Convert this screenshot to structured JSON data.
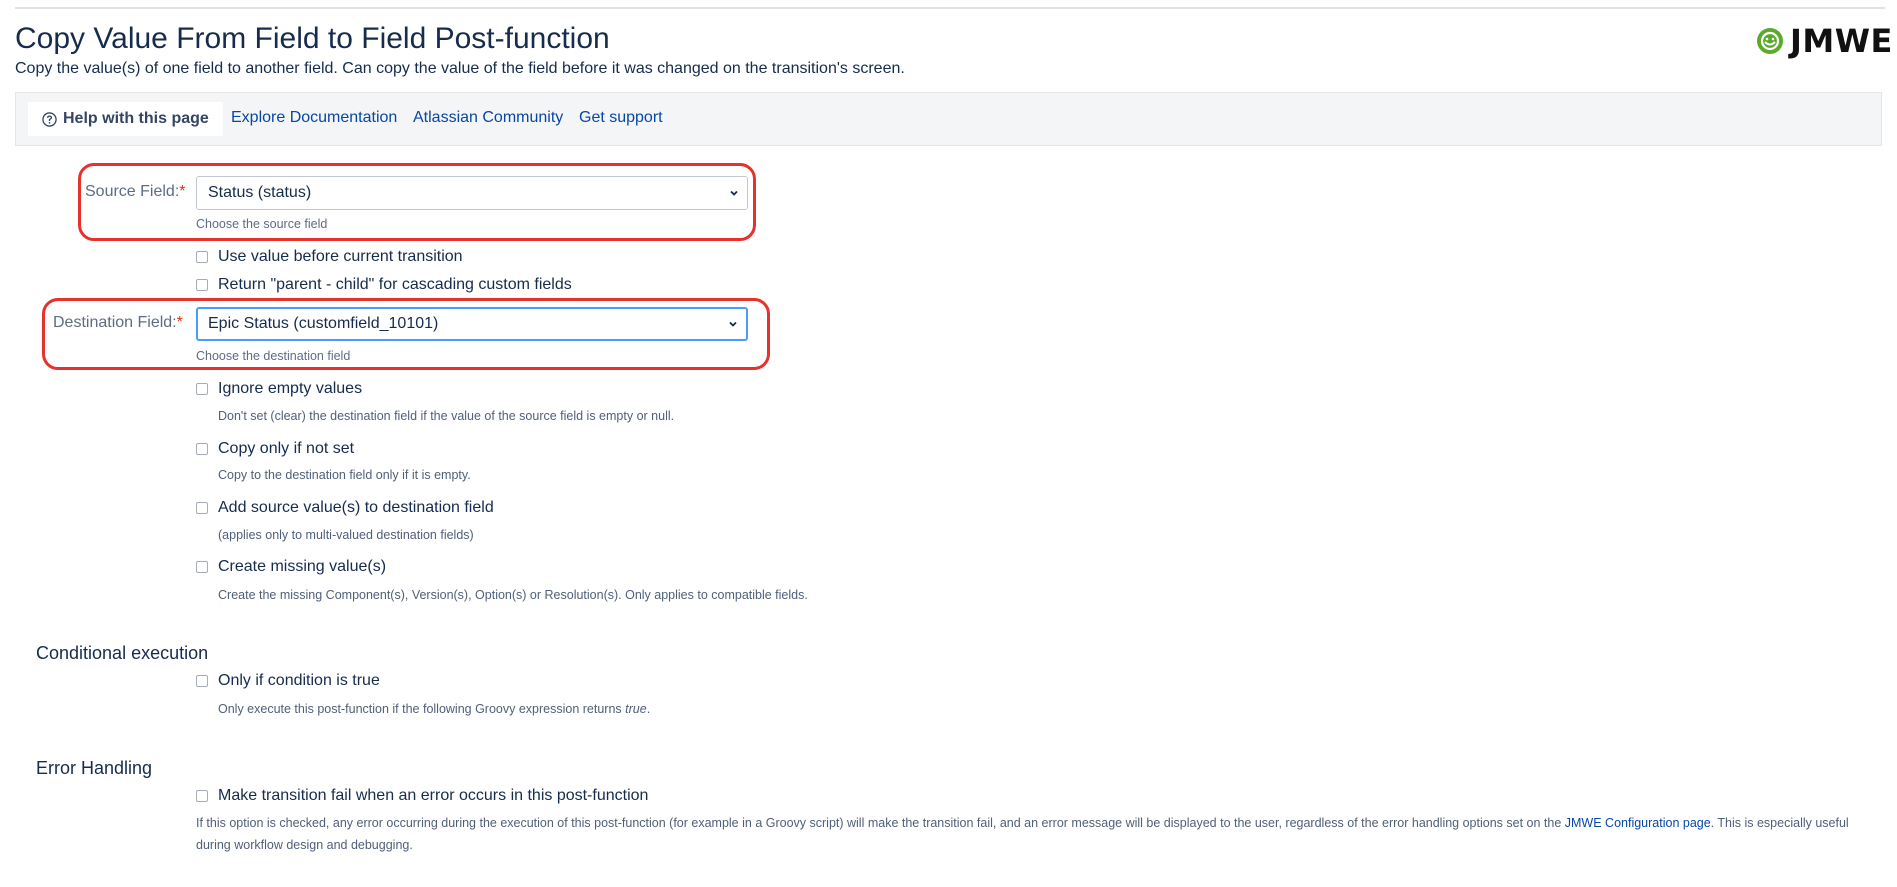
{
  "page": {
    "title": "Copy Value From Field to Field Post-function",
    "subtitle": "Copy the value(s) of one field to another field. Can copy the value of the field before it was changed on the transition's screen."
  },
  "logo": {
    "text": "JMWE",
    "icon": "jmwe-gear-icon",
    "color": "#5aab2a"
  },
  "helpbar": {
    "help_label": "Help with this page",
    "links": [
      "Explore Documentation",
      "Atlassian Community",
      "Get support"
    ]
  },
  "source_field": {
    "label": "Source Field:",
    "required_mark": "*",
    "value": "Status (status)",
    "hint": "Choose the source field"
  },
  "source_options": [
    {
      "label": "Use value before current transition",
      "checked": false
    },
    {
      "label": "Return \"parent - child\" for cascading custom fields",
      "checked": false
    }
  ],
  "destination_field": {
    "label": "Destination Field:",
    "required_mark": "*",
    "value": "Epic Status (customfield_10101)",
    "hint": "Choose the destination field"
  },
  "destination_options": [
    {
      "label": "Ignore empty values",
      "desc": "Don't set (clear) the destination field if the value of the source field is empty or null.",
      "checked": false
    },
    {
      "label": "Copy only if not set",
      "desc": "Copy to the destination field only if it is empty.",
      "checked": false
    },
    {
      "label": "Add source value(s) to destination field",
      "desc": "(applies only to multi-valued destination fields)",
      "checked": false
    },
    {
      "label": "Create missing value(s)",
      "desc": "Create the missing Component(s), Version(s), Option(s) or Resolution(s). Only applies to compatible fields.",
      "checked": false
    }
  ],
  "conditional": {
    "title": "Conditional execution",
    "option_label": "Only if condition is true",
    "desc_prefix": "Only execute this post-function if the following Groovy expression returns ",
    "desc_em": "true",
    "desc_suffix": "."
  },
  "error_handling": {
    "title": "Error Handling",
    "option_label": "Make transition fail when an error occurs in this post-function",
    "desc_before": "If this option is checked, any error occurring during the execution of this post-function (for example in a Groovy script) will make the transition fail, and an error message will be displayed to the user, regardless of the error handling options set on the ",
    "desc_link": "JMWE Configuration page",
    "desc_after": ". This is especially useful during workflow design and debugging."
  },
  "colors": {
    "highlight": "#e5322d",
    "link": "#0747a6",
    "focus": "#4c9aff"
  }
}
